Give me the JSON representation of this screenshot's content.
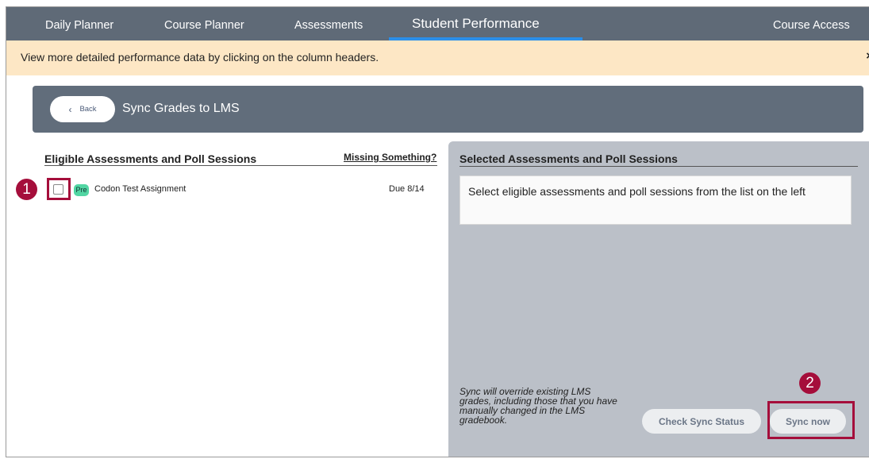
{
  "nav": {
    "items": [
      "Daily Planner",
      "Course Planner",
      "Assessments",
      "Student Performance"
    ],
    "active": "Student Performance",
    "right_item": "Course Access"
  },
  "info": {
    "text": "View more detailed performance data by clicking on the column headers.",
    "close": "×"
  },
  "header": {
    "back_label": "Back",
    "title": "Sync Grades to LMS"
  },
  "left": {
    "title": "Eligible Assessments and Poll Sessions",
    "missing_link": "Missing Something?",
    "rows": [
      {
        "tag": "Pre",
        "name": "Codon Test Assignment",
        "due": "Due 8/14",
        "checked": false
      }
    ]
  },
  "right": {
    "title": "Selected Assessments and Poll Sessions",
    "placeholder": "Select eligible assessments and poll sessions from the list on the left",
    "note": "Sync will override existing LMS grades, including those that you have manually changed in the LMS gradebook.",
    "check_sync_label": "Check Sync Status",
    "sync_now_label": "Sync now"
  },
  "callouts": {
    "one": "1",
    "two": "2"
  },
  "colors": {
    "nav_bg": "#5f6a77",
    "active_underline": "#2b8ee8",
    "info_bg": "#fde7c5",
    "callout": "#a50e3b",
    "pre_tag": "#52d6a3",
    "right_panel_bg": "#bbc0c8"
  }
}
